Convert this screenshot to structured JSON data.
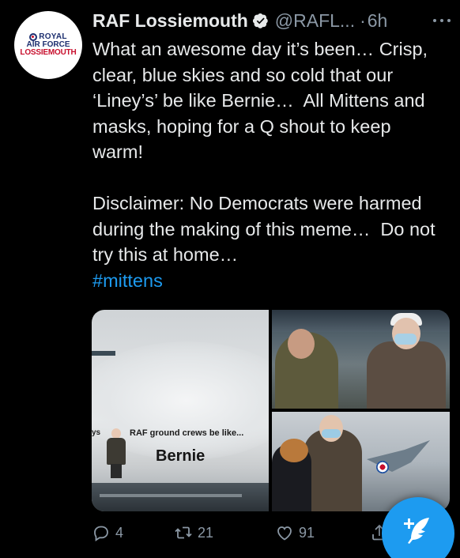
{
  "avatar": {
    "line1": "ROYAL",
    "line2": "AIR FORCE",
    "line3": "LOSSIEMOUTH",
    "icon": "raf-roundel-logo"
  },
  "header": {
    "name": "RAF Lossiemouth",
    "verified_icon": "verified-badge-icon",
    "handle": "@RAFL...",
    "separator": "·",
    "time": "6h",
    "more_icon": "more-options-icon"
  },
  "tweet": {
    "text": "What an awesome day it’s been… Crisp, clear, blue skies and so cold that our ‘Liney’s’ be like Bernie…  All Mittens and masks, hoping for a Q shout to keep warm!\n\nDisclaimer: No Democrats were harmed during the making of this meme…  Do not try this at home…",
    "hashtag": "#mittens"
  },
  "media": {
    "image1": {
      "edge_text": "ys",
      "caption_top": "RAF ground crews be like...",
      "caption_main": "Bernie"
    }
  },
  "actions": {
    "reply": {
      "count": "4",
      "icon": "reply-icon"
    },
    "retweet": {
      "count": "21",
      "icon": "retweet-icon"
    },
    "like": {
      "count": "91",
      "icon": "heart-icon"
    },
    "share": {
      "icon": "share-icon"
    }
  },
  "compose": {
    "icon": "compose-tweet-icon"
  },
  "colors": {
    "accent": "#1d9bf0",
    "text": "#e7e9ea",
    "muted": "#8b98a5",
    "background": "#000000"
  }
}
